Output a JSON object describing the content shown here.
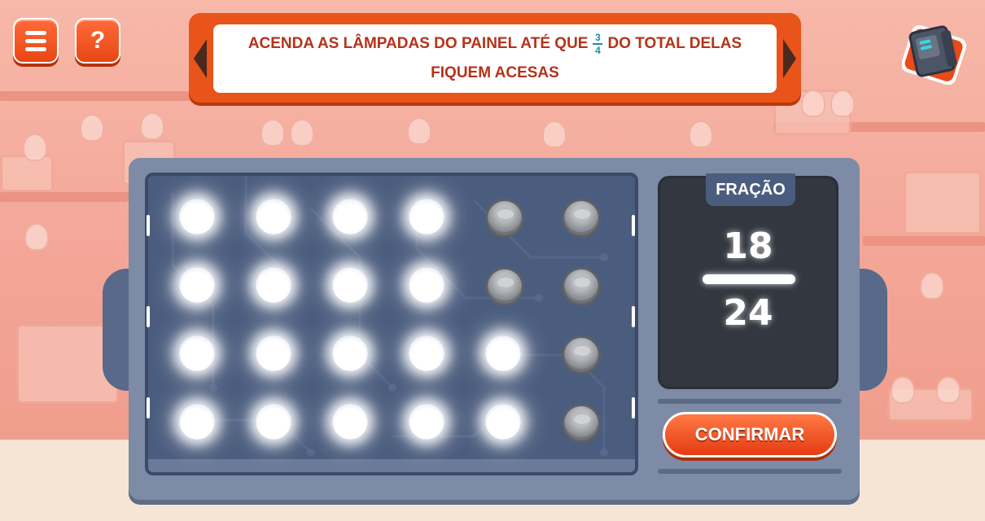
{
  "top_bar": {
    "menu_icon": "hamburger-menu-icon",
    "help_label": "?",
    "toolbox_icon": "toolbox-icon"
  },
  "instruction": {
    "line1_prefix": "ACENDA AS LÂMPADAS DO PAINEL ATÉ QUE",
    "fraction_numerator": "3",
    "fraction_denominator": "4",
    "line1_suffix": "DO TOTAL DELAS",
    "line2": "FIQUEM ACESAS"
  },
  "bulb_grid": {
    "rows": [
      [
        "on",
        "on",
        "on",
        "on",
        "off",
        "off"
      ],
      [
        "on",
        "on",
        "on",
        "on",
        "off",
        "off"
      ],
      [
        "on",
        "on",
        "on",
        "on",
        "on",
        "off"
      ],
      [
        "on",
        "on",
        "on",
        "on",
        "on",
        "off"
      ]
    ]
  },
  "fraction_display": {
    "label": "FRAÇÃO",
    "numerator": "18",
    "denominator": "24"
  },
  "confirm_label": "CONFIRMAR",
  "colors": {
    "accent_orange": "#e85419",
    "banner_text": "#b5321a",
    "fraction_accent": "#1f8aa8",
    "panel": "#7d8ba6",
    "board": "#4b5d7e"
  }
}
